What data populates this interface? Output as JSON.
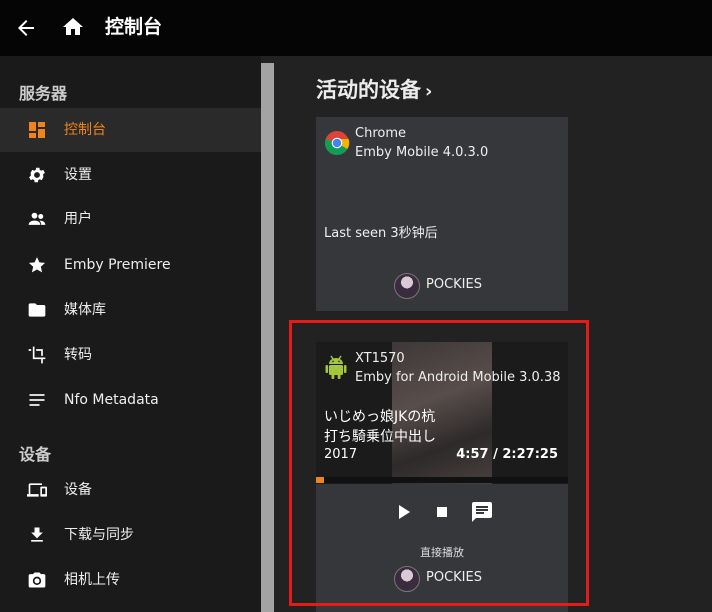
{
  "header": {
    "title": "控制台"
  },
  "sidebar": {
    "section1": "服务器",
    "items1": [
      {
        "label": "控制台",
        "icon": "dashboard-icon",
        "active": true
      },
      {
        "label": "设置",
        "icon": "gear-icon"
      },
      {
        "label": "用户",
        "icon": "users-icon"
      },
      {
        "label": "Emby Premiere",
        "icon": "star-icon"
      },
      {
        "label": "媒体库",
        "icon": "folder-icon"
      },
      {
        "label": "转码",
        "icon": "crop-icon"
      },
      {
        "label": "Nfo Metadata",
        "icon": "lines-icon"
      }
    ],
    "section2": "设备",
    "items2": [
      {
        "label": "设备",
        "icon": "devices-icon"
      },
      {
        "label": "下载与同步",
        "icon": "download-icon"
      },
      {
        "label": "相机上传",
        "icon": "camera-icon"
      }
    ]
  },
  "main": {
    "heading": "活动的设备",
    "devices": [
      {
        "device": "Chrome",
        "app": "Emby Mobile 4.0.3.0",
        "last_seen": "Last seen 3秒钟后",
        "user": "POCKIES"
      },
      {
        "device": "XT1570",
        "app": "Emby for Android Mobile 3.0.38",
        "now_playing_line1": "いじめっ娘JKの杭",
        "now_playing_line2": "打ち騎乗位中出し",
        "year": "2017",
        "time": "4:57 / 2:27:25",
        "progress": 0.033,
        "play_method": "直接播放",
        "user": "POCKIES"
      }
    ]
  },
  "colors": {
    "accent": "#f0841c",
    "highlight": "#e31b1b"
  }
}
